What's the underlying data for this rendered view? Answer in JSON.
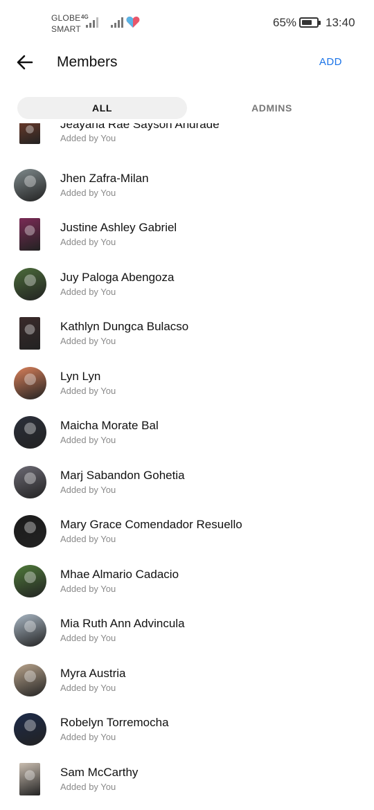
{
  "status_bar": {
    "carrier_1": "GLOBE",
    "carrier_2": "SMART",
    "network": "4G",
    "battery": "65%",
    "time": "13:40"
  },
  "header": {
    "back_icon": "back-arrow-icon",
    "title": "Members",
    "add_label": "ADD"
  },
  "tabs": [
    {
      "label": "ALL",
      "selected": true
    },
    {
      "label": "ADMINS",
      "selected": false
    }
  ],
  "members": [
    {
      "name": "Jeayana Rae Sayson Andrade",
      "subtitle": "Added by You",
      "avatar_color": "#6b3a2a"
    },
    {
      "name": "Jhen Zafra-Milan",
      "subtitle": "Added by You",
      "avatar_color": "#7f8a8c"
    },
    {
      "name": "Justine Ashley Gabriel",
      "subtitle": "Added by You",
      "avatar_color": "#7a2a55"
    },
    {
      "name": "Juy Paloga Abengoza",
      "subtitle": "Added by You",
      "avatar_color": "#4b6b3a"
    },
    {
      "name": "Kathlyn Dungca Bulacso",
      "subtitle": "Added by You",
      "avatar_color": "#3a2a2a"
    },
    {
      "name": "Lyn Lyn",
      "subtitle": "Added by You",
      "avatar_color": "#d9805a"
    },
    {
      "name": "Maicha Morate Bal",
      "subtitle": "Added by You",
      "avatar_color": "#2b2f3a"
    },
    {
      "name": "Marj Sabandon Gohetia",
      "subtitle": "Added by You",
      "avatar_color": "#6c6a74"
    },
    {
      "name": "Mary Grace Comendador Resuello",
      "subtitle": "Added by You",
      "avatar_color": "#1b1b1b"
    },
    {
      "name": "Mhae Almario Cadacio",
      "subtitle": "Added by You",
      "avatar_color": "#4f7a3a"
    },
    {
      "name": "Mia Ruth Ann Advincula",
      "subtitle": "Added by You",
      "avatar_color": "#a9b7c4"
    },
    {
      "name": "Myra Austria",
      "subtitle": "Added by You",
      "avatar_color": "#b9a48c"
    },
    {
      "name": "Robelyn Torremocha",
      "subtitle": "Added by You",
      "avatar_color": "#1d2b4a"
    },
    {
      "name": "Sam McCarthy",
      "subtitle": "Added by You",
      "avatar_color": "#c9bdb0"
    }
  ]
}
